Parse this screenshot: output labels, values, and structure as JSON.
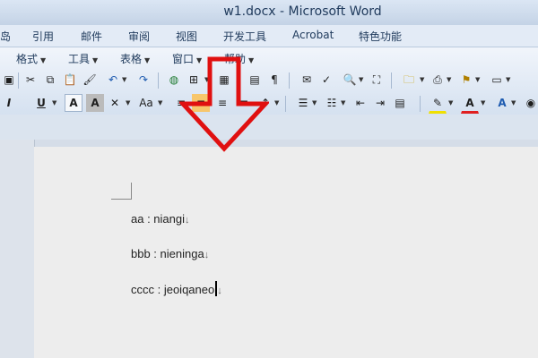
{
  "window": {
    "title": "w1.docx - Microsoft Word"
  },
  "ribbon_tabs": [
    "岛",
    "引用",
    "邮件",
    "审阅",
    "视图",
    "开发工具",
    "Acrobat",
    "特色功能"
  ],
  "menu": [
    "格式",
    "工具",
    "表格",
    "窗口",
    "帮助"
  ],
  "format_row": {
    "bold_label": "I",
    "underline_label": "U",
    "char_shade_label": "A",
    "change_case_label": "Aa"
  },
  "document": {
    "lines": [
      {
        "text": "aa : niangi",
        "mark": "↓"
      },
      {
        "text": "bbb : nieninga",
        "mark": "↓"
      },
      {
        "text": "cccc : jeoiqaneo",
        "mark": "↓"
      }
    ]
  },
  "colors": {
    "arrow": "#e01010",
    "font_color": "#e02020",
    "highlight": "#f0e000"
  }
}
